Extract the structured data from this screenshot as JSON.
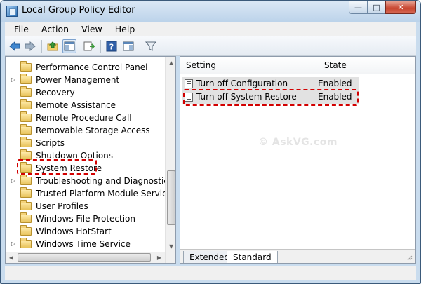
{
  "window": {
    "title": "Local Group Policy Editor",
    "minimize_glyph": "—",
    "maximize_glyph": "□",
    "close_glyph": "✕"
  },
  "menu": [
    "File",
    "Action",
    "View",
    "Help"
  ],
  "toolbar": {
    "icons": [
      "back-icon",
      "forward-icon",
      "up-folder-icon",
      "show-hide-tree-icon",
      "export-list-icon",
      "help-icon",
      "show-hide-action-pane-icon",
      "filter-icon"
    ]
  },
  "tree": {
    "items": [
      {
        "label": "Performance Control Panel",
        "expandable": false
      },
      {
        "label": "Power Management",
        "expandable": true
      },
      {
        "label": "Recovery",
        "expandable": false
      },
      {
        "label": "Remote Assistance",
        "expandable": false
      },
      {
        "label": "Remote Procedure Call",
        "expandable": false
      },
      {
        "label": "Removable Storage Access",
        "expandable": false
      },
      {
        "label": "Scripts",
        "expandable": false
      },
      {
        "label": "Shutdown Options",
        "expandable": false
      },
      {
        "label": "System Restore",
        "expandable": false,
        "selected": true
      },
      {
        "label": "Troubleshooting and Diagnostics",
        "expandable": true
      },
      {
        "label": "Trusted Platform Module Services",
        "expandable": false
      },
      {
        "label": "User Profiles",
        "expandable": false
      },
      {
        "label": "Windows File Protection",
        "expandable": false
      },
      {
        "label": "Windows HotStart",
        "expandable": false
      },
      {
        "label": "Windows Time Service",
        "expandable": true
      }
    ]
  },
  "details": {
    "columns": {
      "setting": "Setting",
      "state": "State"
    },
    "rows": [
      {
        "setting": "Turn off Configuration",
        "state": "Enabled"
      },
      {
        "setting": "Turn off System Restore",
        "state": "Enabled"
      }
    ],
    "watermark": "© AskVG.com"
  },
  "tabs": [
    {
      "label": "Extended",
      "active": false
    },
    {
      "label": "Standard",
      "active": true
    }
  ],
  "colors": {
    "highlight": "#d20000",
    "selection_row": "#e2e2e2",
    "frame": "#c9dcee"
  }
}
